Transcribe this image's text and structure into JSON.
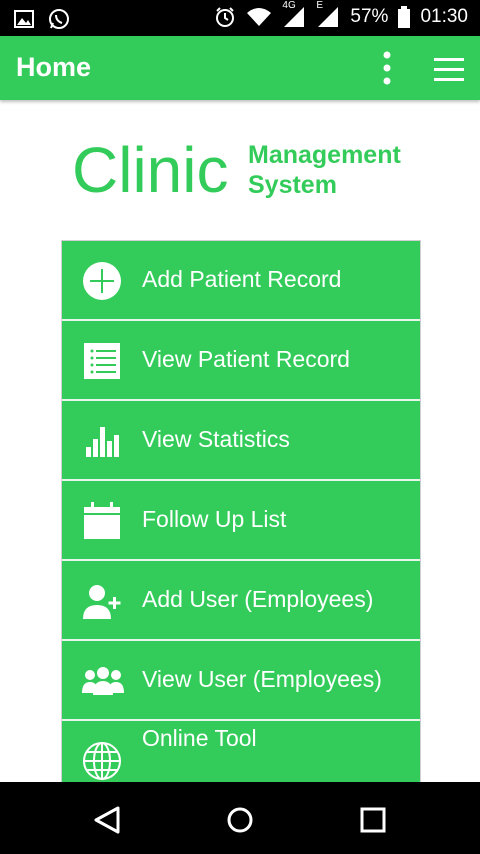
{
  "status_bar": {
    "battery": "57%",
    "time": "01:30",
    "network_4g": "4G",
    "network_e": "E",
    "icons": [
      "gallery-icon",
      "whatsapp-icon",
      "alarm-icon",
      "wifi-icon",
      "signal-icon",
      "signal-icon",
      "battery-icon"
    ]
  },
  "app_bar": {
    "title": "Home",
    "color": "#33cc5a"
  },
  "brand": {
    "name": "Clinic",
    "subtitle_line1": "Management",
    "subtitle_line2": "System"
  },
  "menu": {
    "items": [
      {
        "label": "Add Patient Record",
        "icon": "add-circle-icon"
      },
      {
        "label": "View Patient Record",
        "icon": "list-icon"
      },
      {
        "label": "View Statistics",
        "icon": "bar-chart-icon"
      },
      {
        "label": "Follow Up List",
        "icon": "calendar-icon"
      },
      {
        "label": "Add User (Employees)",
        "icon": "add-user-icon"
      },
      {
        "label": "View User (Employees)",
        "icon": "users-icon"
      },
      {
        "label": "Online Tool",
        "icon": "globe-icon"
      }
    ]
  },
  "nav_bar": {
    "icons": [
      "back-icon",
      "home-icon",
      "recents-icon"
    ]
  }
}
